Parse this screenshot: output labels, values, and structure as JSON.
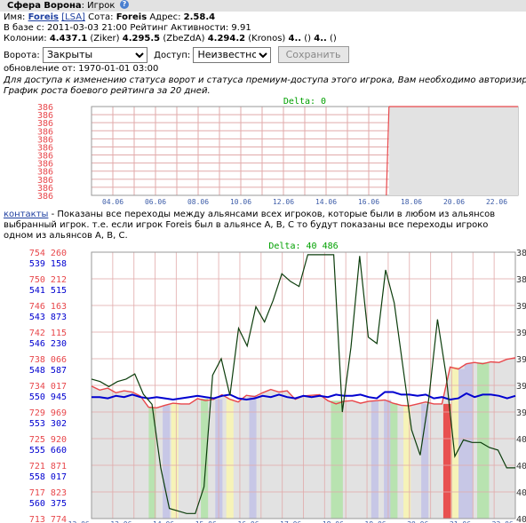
{
  "header": {
    "title": "Сфера Ворона",
    "subtitle": ": Игрок",
    "help_icon": "?"
  },
  "info": {
    "name_label": "Имя:",
    "name": "Foreis",
    "alliance": "[LSA]",
    "sota_label": "Сота:",
    "sota": "Foreis",
    "address_label": "Адрес:",
    "address": "2.58.4",
    "base_line": "В базе с: 2011-03-03 21:00 Рейтинг Активности: 9.91",
    "colonies_label": "Колонии:",
    "colonies": [
      {
        "coord": "4.437.1",
        "name": "(Ziker)"
      },
      {
        "coord": "4.295.5",
        "name": "(ZbeZdA)"
      },
      {
        "coord": "4.294.2",
        "name": "(Kronos)"
      },
      {
        "coord": "4..",
        "name": "()"
      },
      {
        "coord": "4..",
        "name": "()"
      }
    ]
  },
  "controls": {
    "gate_label": "Ворота:",
    "gate_value": "Закрыты",
    "access_label": "Доступ:",
    "access_value": "Неизвестно",
    "save_label": "Сохранить"
  },
  "update_line": "обновление от: 1970-01-01 03:00",
  "notice1": "Для доступа к изменению статуса ворот и статуса премиум-доступа этого игрока, Вам необходимо авторизирова",
  "notice2": "График роста боевого рейтинга за 20 дней.",
  "contacts": {
    "link": "контакты",
    "text1": " - Показаны все переходы между альянсами всех игроков, которые были в любом из альянсов",
    "text2": "выбранный игрок. т.е. если игрок Foreis был в альянсе A, B, C то будут показаны все переходы игроко",
    "text3": "одном из альянсов A, B, C."
  },
  "colors": {
    "red": "#e8474b",
    "blue": "#0000d0",
    "green": "#0c3d0c",
    "grid": "#e1aaaa",
    "gray_fill": "#e2e2e2"
  },
  "chart_data": [
    {
      "type": "area",
      "title": "Delta: 0",
      "y_tick_labels": [
        "386",
        "386",
        "386",
        "386",
        "386",
        "386",
        "386",
        "386",
        "386",
        "386",
        "386",
        "386"
      ],
      "x_tick_labels": [
        "04.06",
        "06.06",
        "08.06",
        "10.06",
        "12.06",
        "14.06",
        "16.06",
        "18.06",
        "20.06",
        "22.06"
      ],
      "x": [
        "03.06",
        "04.06",
        "05.06",
        "06.06",
        "07.06",
        "08.06",
        "09.06",
        "10.06",
        "11.06",
        "12.06",
        "13.06",
        "14.06",
        "15.06",
        "16.06",
        "17.06",
        "18.06",
        "19.06",
        "20.06",
        "21.06",
        "22.06",
        "23.06"
      ],
      "series": [
        {
          "values": [
            null,
            null,
            null,
            null,
            null,
            null,
            null,
            null,
            null,
            null,
            null,
            null,
            null,
            null,
            386,
            386,
            386,
            386,
            386,
            386,
            386
          ]
        }
      ]
    },
    {
      "type": "line",
      "title": "Delta: 40 486",
      "left_axis_red": [
        "754 260",
        "750 212",
        "746 163",
        "742 115",
        "738 066",
        "734 017",
        "729 969",
        "725 920",
        "721 871",
        "717 823",
        "713 774"
      ],
      "left_axis_blue": [
        "539 158",
        "541 515",
        "543 873",
        "546 230",
        "548 587",
        "550 945",
        "553 302",
        "555 660",
        "558 017",
        "560 375"
      ],
      "right_axis": [
        "386",
        "388",
        "390",
        "392",
        "394",
        "396",
        "398",
        "401",
        "403",
        "405",
        "407"
      ],
      "x_tick_labels": [
        "12.06",
        "13.06",
        "14.06",
        "15.06",
        "16.06",
        "17.06",
        "18.06",
        "19.06",
        "20.06",
        "21.06",
        "22.06"
      ],
      "series": [
        {
          "color": "red",
          "values": [
            733900,
            733300,
            733600,
            732900,
            733200,
            733000,
            732400,
            730700,
            730600,
            731000,
            731300,
            731200,
            731200,
            732000,
            731700,
            731900,
            732600,
            731900,
            731500,
            732500,
            732300,
            732900,
            733400,
            733000,
            733200,
            731900,
            732400,
            732500,
            732600,
            731700,
            731200,
            731600,
            731700,
            731300,
            731600,
            731700,
            731800,
            731300,
            731000,
            730900,
            731200,
            731500,
            731200,
            731200,
            736800,
            736500,
            737300,
            737500,
            737300,
            737600,
            737500,
            738000,
            738200
          ]
        },
        {
          "color": "blue",
          "values": [
            550700,
            550700,
            550800,
            550600,
            550700,
            550500,
            550700,
            550800,
            550700,
            550800,
            550900,
            550800,
            550700,
            550600,
            550700,
            550800,
            550600,
            550500,
            550800,
            550900,
            550800,
            550600,
            550700,
            550500,
            550700,
            550800,
            550600,
            550700,
            550600,
            550700,
            550500,
            550600,
            550600,
            550500,
            550700,
            550800,
            550300,
            550300,
            550500,
            550500,
            550600,
            550500,
            550800,
            550700,
            550900,
            550800,
            550400,
            550700,
            550500,
            550500,
            550600,
            550800,
            550600
          ]
        },
        {
          "color": "green",
          "values": [
            396.0,
            396.2,
            396.6,
            396.2,
            396.0,
            395.6,
            397.2,
            398.0,
            403.0,
            406.2,
            406.4,
            406.6,
            406.6,
            404.5,
            395.7,
            394.4,
            397.3,
            392.0,
            393.4,
            390.3,
            391.5,
            389.8,
            387.7,
            388.3,
            388.7,
            386.2,
            386.2,
            386.2,
            386.2,
            398.6,
            393.5,
            386.3,
            392.7,
            393.2,
            387.4,
            390.0,
            395.0,
            400.0,
            402.0,
            397.5,
            391.3,
            395.7,
            402.1,
            400.8,
            401.0,
            401.0,
            401.4,
            401.6,
            403.0,
            403.0
          ]
        }
      ]
    }
  ]
}
